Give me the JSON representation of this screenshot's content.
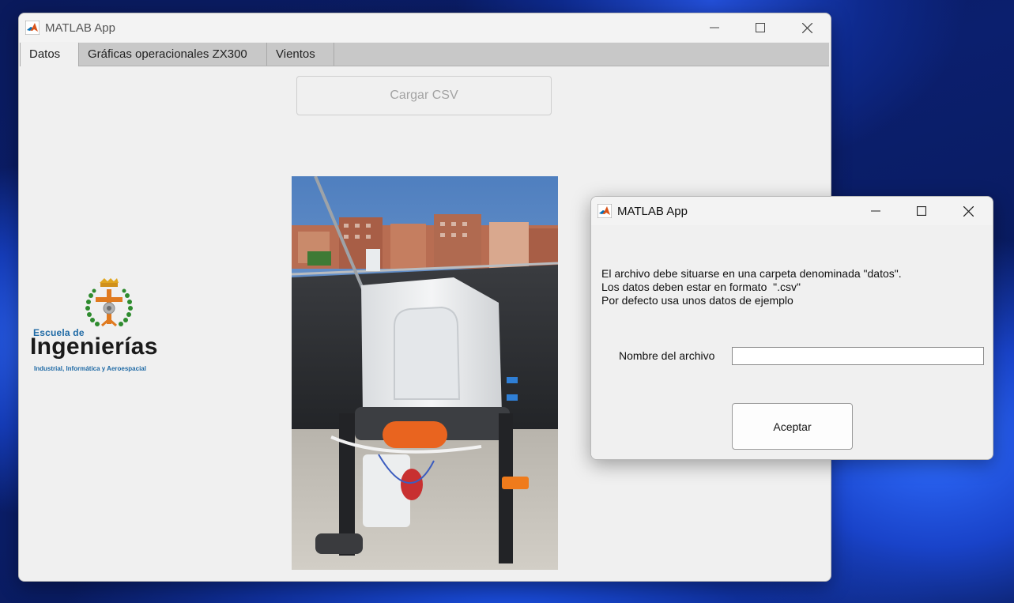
{
  "main_window": {
    "title": "MATLAB App",
    "tabs": [
      {
        "label": "Datos"
      },
      {
        "label": "Gráficas operacionales ZX300"
      },
      {
        "label": "Vientos"
      }
    ],
    "load_button_label": "Cargar CSV",
    "load_button_enabled": false,
    "logo": {
      "line1": "Escuela de",
      "line2": "Ingenierías",
      "line3": "Industrial, Informática y Aeroespacial"
    }
  },
  "dialog": {
    "title": "MATLAB App",
    "message": "El archivo debe situarse en una carpeta denominada \"datos\".\nLos datos deben estar en formato  \".csv\"\nPor defecto usa unos datos de ejemplo",
    "field_label": "Nombre del archivo",
    "field_value": "",
    "accept_label": "Aceptar"
  },
  "colors": {
    "window_bg": "#f0f0f0",
    "tabstrip_bg": "#c8c8c8",
    "logo_blue": "#1f6aa5",
    "logo_green": "#2e8b2e",
    "logo_orange": "#e07a1f"
  },
  "icons": [
    "matlab-icon",
    "minimize-icon",
    "maximize-icon",
    "close-icon"
  ]
}
